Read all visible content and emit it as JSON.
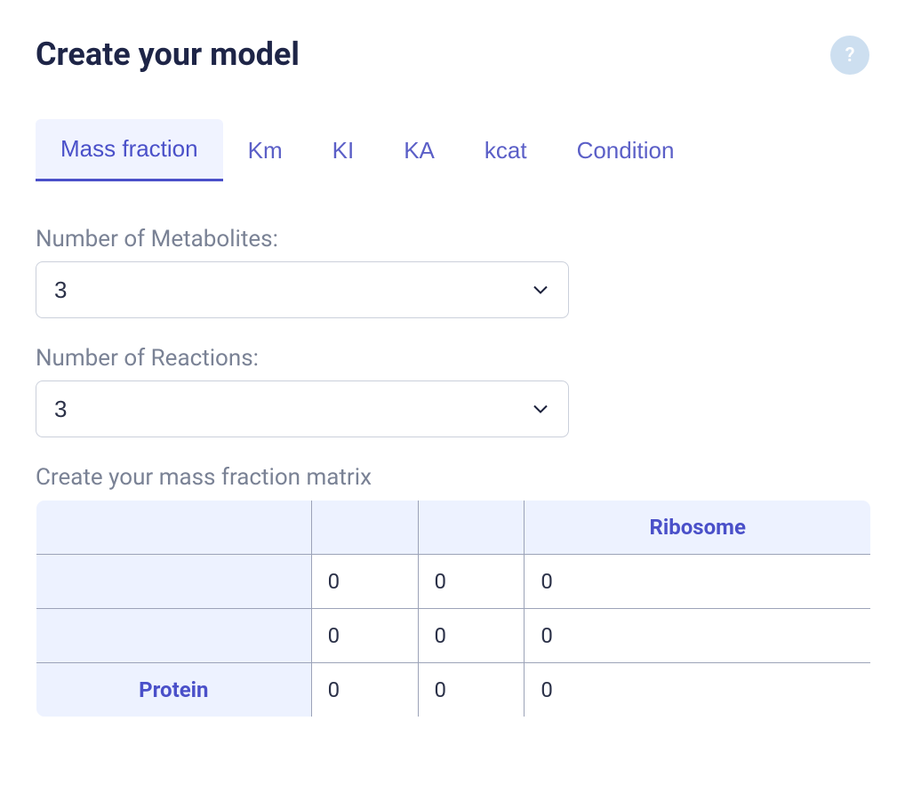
{
  "header": {
    "title": "Create your model",
    "help_icon_label": "?"
  },
  "tabs": [
    {
      "label": "Mass fraction",
      "active": true
    },
    {
      "label": "Km",
      "active": false
    },
    {
      "label": "KI",
      "active": false
    },
    {
      "label": "KA",
      "active": false
    },
    {
      "label": "kcat",
      "active": false
    },
    {
      "label": "Condition",
      "active": false
    }
  ],
  "form": {
    "metabolites_label": "Number of Metabolites:",
    "metabolites_value": "3",
    "reactions_label": "Number of Reactions:",
    "reactions_value": "3"
  },
  "matrix": {
    "label": "Create your mass fraction matrix",
    "col_headers": [
      "",
      "",
      "",
      "Ribosome"
    ],
    "rows": [
      {
        "header": "",
        "cells": [
          "0",
          "0",
          "0"
        ]
      },
      {
        "header": "",
        "cells": [
          "0",
          "0",
          "0"
        ]
      },
      {
        "header": "Protein",
        "cells": [
          "0",
          "0",
          "0"
        ]
      }
    ]
  }
}
